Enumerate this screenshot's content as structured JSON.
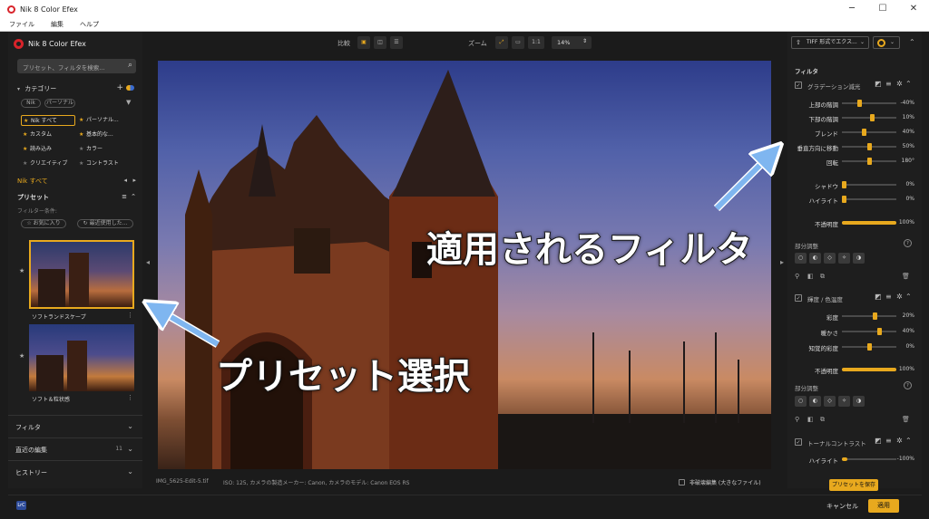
{
  "window": {
    "title": "Nik 8 Color Efex",
    "minimize": "─",
    "maximize": "☐",
    "close": "✕"
  },
  "menu": [
    "ファイル",
    "編集",
    "ヘルプ"
  ],
  "left": {
    "app_name": "Nik 8 Color Efex",
    "search_placeholder": "プリセット、フィルタを検索...",
    "category_title": "カテゴリー",
    "chips": [
      "Nik",
      "パーソナル"
    ],
    "categories": [
      "Nik すべて",
      "パーソナル...",
      "カスタム",
      "基本的な...",
      "読み込み",
      "カラー",
      "クリエイティブ",
      "コントラスト"
    ],
    "current_category": "Nik すべて",
    "presets_title": "プリセット",
    "filter_condition": "フィルター条件:",
    "favorites": "☆ お気に入り",
    "recent": "↻ 最近使用した...",
    "presets": [
      "ソフトランドスケープ",
      "ソフト＆粒状感"
    ],
    "bottom_sections": [
      {
        "label": "フィルタ",
        "count": ""
      },
      {
        "label": "直近の編集",
        "count": "11"
      },
      {
        "label": "ヒストリー",
        "count": ""
      }
    ]
  },
  "toolbar": {
    "compare_label": "比較",
    "zoom_label": "ズーム",
    "zoom_1to1": "1:1",
    "zoom_value": "14%"
  },
  "status": {
    "filename": "IMG_5625-Edit-5.tif",
    "meta": "ISO: 125, カメラの製造メーカー: Canon, カメラのモデル: Canon EOS RS",
    "nondestructive": "非破壊編集 (大きなファイル)"
  },
  "right": {
    "export_label": "TIFF 形式でエクス...",
    "filter_title": "フィルタ",
    "filters": [
      {
        "name": "グラデーション減光",
        "sliders": [
          {
            "label": "上部の階調",
            "value": "-40%",
            "pos": 0.3
          },
          {
            "label": "下部の階調",
            "value": "10%",
            "pos": 0.55
          },
          {
            "label": "ブレンド",
            "value": "40%",
            "pos": 0.4
          },
          {
            "label": "垂直方向に移動",
            "value": "50%",
            "pos": 0.5
          },
          {
            "label": "回転",
            "value": "180°",
            "pos": 0.5
          },
          {
            "label": "シャドウ",
            "value": "0%",
            "pos": 0.0
          },
          {
            "label": "ハイライト",
            "value": "0%",
            "pos": 0.0
          },
          {
            "label": "不透明度",
            "value": "100%",
            "pos": 1.0
          }
        ],
        "partial": "部分調整"
      },
      {
        "name": "輝度 / 色温度",
        "sliders": [
          {
            "label": "彩度",
            "value": "20%",
            "pos": 0.6
          },
          {
            "label": "暖かさ",
            "value": "40%",
            "pos": 0.7
          },
          {
            "label": "知覚的彩度",
            "value": "0%",
            "pos": 0.5
          },
          {
            "label": "不透明度",
            "value": "100%",
            "pos": 1.0
          }
        ],
        "partial": "部分調整"
      },
      {
        "name": "トーナルコントラスト",
        "sliders": [
          {
            "label": "ハイライト",
            "value": "-100%",
            "pos": 0.0
          }
        ]
      }
    ],
    "save_preset": "プリセットを保存"
  },
  "footer": {
    "badge": "LrC",
    "cancel": "キャンセル",
    "apply": "適用"
  },
  "annotations": {
    "filter_applied": "適用されるフィルタ",
    "preset_select": "プリセット選択"
  },
  "colors": {
    "accent": "#e8a91e",
    "annotation_arrow": "#7fb6f0"
  }
}
